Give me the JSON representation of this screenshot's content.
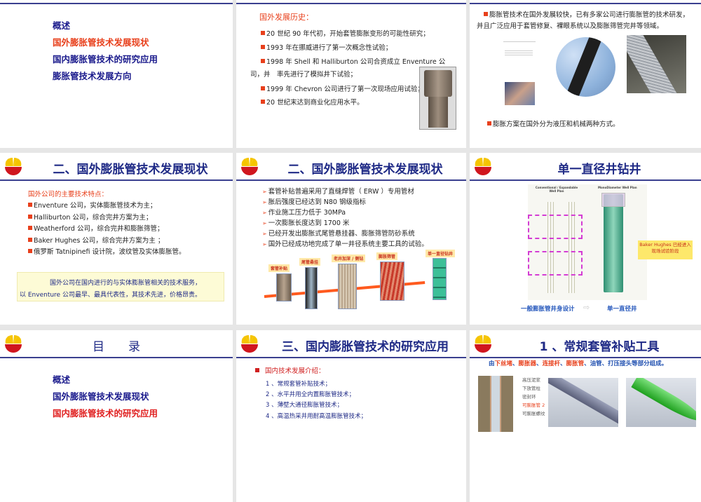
{
  "toc_slide": {
    "items": [
      "概述",
      "国外膨胀管技术发展现状",
      "国内膨胀管技术的研究应用",
      "膨胀管技术发展方向"
    ],
    "active_index": 1
  },
  "history_slide": {
    "heading": "国外发展历史：",
    "bullets": [
      "20 世纪 90 年代初，开始套管膨胀变形的可能性研究；",
      "1993 年在挪威进行了第一次概念性试验；",
      "1998 年 Shell 和 Halliburton 公司合资成立 Enventure 公",
      "1999 年 Chevron 公司进行了第一次现场应用试验；",
      "20 世纪末达到商业化应用水平。"
    ],
    "continuation": "司，并　率先进行了模拟井下试验；"
  },
  "overview_slide": {
    "para_line1": "膨胀管技术在国外发展较快，已有多家公司进行膨胀管的技术研发，",
    "para_line2": "并且广泛应用于套管修复、裸眼系统以及膨胀筛管完井等领域。",
    "bullet2": "膨胀方案在国外分为液压和机械两种方式。"
  },
  "companies_slide": {
    "title": "二、国外膨胀管技术发展现状",
    "heading": "国外公司的主要技术特点：",
    "bullets": [
      "Enventure 公司，实体膨胀管技术为主；",
      "Halliburton  公司，综合完井方案为主；",
      "Weatherford  公司，综合完井和膨胀筛管；",
      "Baker Hughes 公司，综合完井方案为主 ；",
      "俄罗斯 Tatnipinefi 设计院，波纹管及实体膨胀管。"
    ],
    "note_line1": "国外公司在国内进行的与实体膨胀管相关的技术服务，",
    "note_line2": "以 Enventure 公司最早、最具代表性，其技术先进，价格昂贵。"
  },
  "status_slide": {
    "title": "二、国外膨胀管技术发展现状",
    "bullets": [
      "套管补贴普遍采用了直缝焊管（ ERW ）专用管材",
      "胀后强度已经达到 N80 钢级指标",
      "作业施工压力低于 30MPa",
      "一次膨胀长度达到 1700 米",
      "已经开发出膨胀式尾管悬挂器、膨胀筛管防砂系统",
      "国外已经成功地完成了单一井径系统主要工具的试验。"
    ],
    "stages": [
      "套管补贴",
      "尾管悬挂",
      "老井加深 / 侧钻",
      "膨胀筛管",
      "单一直径钻井"
    ]
  },
  "mono_slide": {
    "title": "单一直径井钻井",
    "diagram_left_title": "Conventional / Expandable Well Plan",
    "diagram_right_title": "MonoDiameter Well Plan",
    "callout_line1": "Baker Hughes 已经进入",
    "callout_line2": "现场试验阶段",
    "caption_left": "一般膨胀管井身设计",
    "caption_right": "单一直径井"
  },
  "contents_slide": {
    "title": "目　　录",
    "items": [
      "概述",
      "国外膨胀管技术发展现状",
      "国内膨胀管技术的研究应用"
    ],
    "active_index": 2
  },
  "domestic_slide": {
    "title": "三、国内膨胀管技术的研究应用",
    "heading": "国内技术发展介绍：",
    "items": [
      "1 、常规套管补贴技术；",
      "2 、水平井用全内置膨胀管技术；",
      "3 、薄壁大通径膨胀管技术；",
      "4 、高温热采井用耐高温膨胀管技术；"
    ]
  },
  "tool_slide": {
    "title": "1 、常规套管补贴工具",
    "subtitle_segments": [
      {
        "text": "由",
        "color": "#1f4fb0"
      },
      {
        "text": "下丝堵",
        "color": "#e8401c"
      },
      {
        "text": "、",
        "color": "#1f4fb0"
      },
      {
        "text": "膨胀器",
        "color": "#e8401c"
      },
      {
        "text": "、",
        "color": "#1f4fb0"
      },
      {
        "text": "连接杆",
        "color": "#e8401c"
      },
      {
        "text": "、",
        "color": "#1f4fb0"
      },
      {
        "text": "膨胀管",
        "color": "#e8401c"
      },
      {
        "text": "、油管、打压接头等部分组成。",
        "color": "#1f4fb0"
      }
    ],
    "labels": [
      "高压泥浆",
      "下放管柱",
      "密封环",
      "可膨胀管 2",
      "可膨胀螺纹"
    ]
  }
}
